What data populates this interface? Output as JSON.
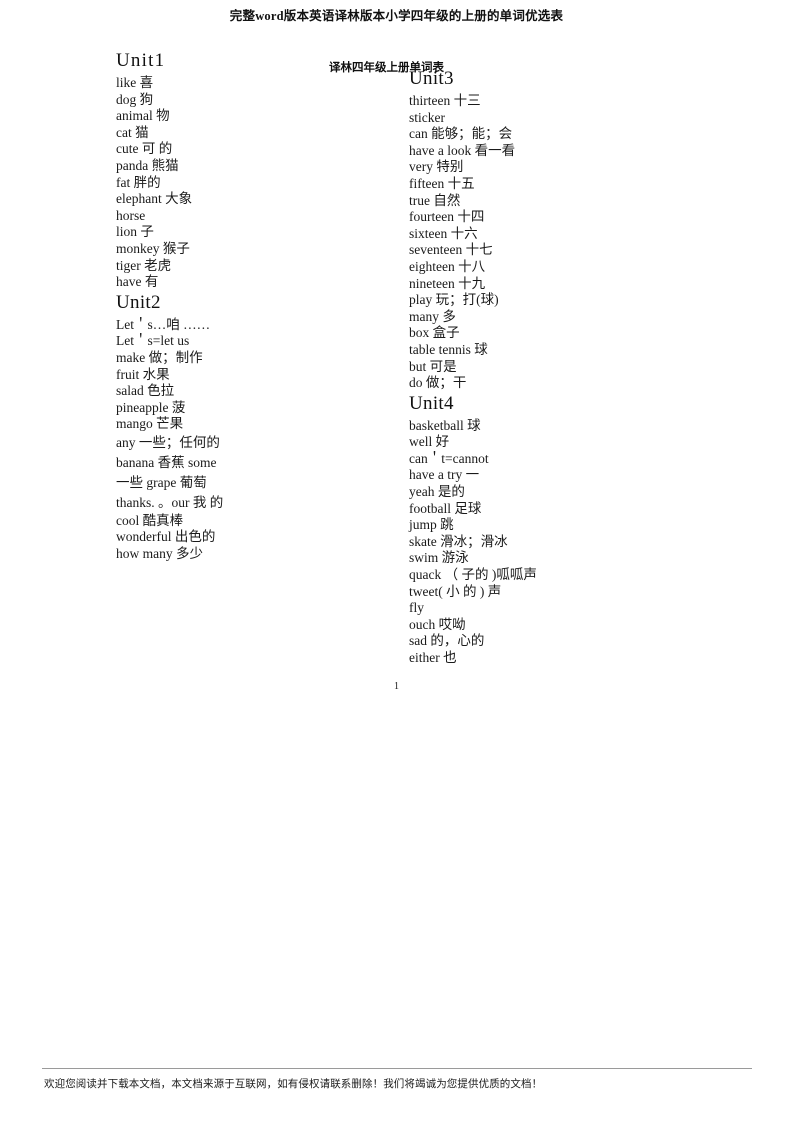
{
  "header": {
    "title": "完整word版本英语译林版本小学四年级的上册的单词优选表"
  },
  "sub_title": "译林四年级上册单词表",
  "page_number": "1",
  "footer": {
    "text": "欢迎您阅读并下载本文档，本文档来源于互联网，如有侵权请联系删除！我们将竭诚为您提供优质的文档！"
  },
  "columns": {
    "left": {
      "units": [
        {
          "title": "Unit1",
          "words": [
            "like 喜",
            "dog 狗",
            "animal 物",
            "cat 猫",
            "cute 可 的",
            "panda 熊猫",
            "fat 胖的",
            "elephant 大象",
            "horse",
            "lion 子",
            "monkey 猴子",
            "tiger 老虎",
            "have 有"
          ]
        },
        {
          "title": "Unit2",
          "words": [
            "Let＇s…咱 ……",
            "Let＇s=let us",
            "make 做；制作",
            "fruit 水果",
            "salad 色拉",
            "pineapple 菠",
            "mango 芒果",
            "any 一些；任何的",
            "banana 香蕉 some",
            "一些 grape 葡萄",
            "thanks.   。our 我 的",
            "cool 酷真棒",
            "wonderful 出色的",
            "how many 多少"
          ]
        }
      ]
    },
    "right": {
      "units": [
        {
          "title": "Unit3",
          "words": [
            "thirteen 十三",
            "sticker",
            "can 能够；能；会",
            "have a look 看一看",
            "very 特别",
            "fifteen 十五",
            "true 自然",
            "fourteen 十四",
            "sixteen 十六",
            "seventeen 十七",
            "eighteen 十八",
            "nineteen 十九",
            "play 玩；打(球)",
            "many 多",
            "box 盒子",
            "table tennis 球",
            "but 可是",
            "do 做；干"
          ]
        },
        {
          "title": "Unit4",
          "words": [
            "basketball 球",
            "well 好",
            "can＇t=cannot",
            "have a try 一",
            "yeah 是的",
            "football 足球",
            "jump 跳",
            "skate 滑冰；滑冰",
            "swim 游泳",
            "quack （ 子的 )呱呱声",
            "tweet( 小 的 ) 声",
            "fly",
            "ouch 哎呦",
            "sad 的，心的",
            "either 也"
          ]
        }
      ]
    }
  }
}
